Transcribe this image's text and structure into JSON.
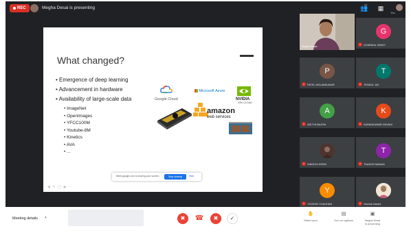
{
  "topbar": {
    "rec_label": "REC",
    "presenting_text": "Megha Desai is presenting",
    "people_count": "27",
    "chat_label": "",
    "you_label": "You"
  },
  "slide": {
    "title": "What changed?",
    "bullets": [
      "Emergence of deep learning",
      "Advancement in hardware",
      "Availability of large-scale data"
    ],
    "sub_bullets": [
      "ImageNet",
      "OpenImages",
      "YFCC100M",
      "Youtube-8M",
      "Kinetics",
      "AVA",
      "..."
    ],
    "logos": {
      "google_cloud": "Google Cloud",
      "microsoft_azure": "Microsoft Azure",
      "nvidia": "NVIDIA",
      "nvidia_sub": "GPU CLOUD",
      "amazon": "amazon",
      "aws": "web services"
    },
    "share_bar": {
      "message": "Meet.google.com is sharing your screen.",
      "stop_label": "Stop sharing",
      "hide_label": "Hide"
    }
  },
  "participants": {
    "presenter_name": "Megha Desai",
    "tiles": [
      {
        "initial": "G",
        "name": "GUNDMAL SWATI",
        "color": "#e8336d"
      },
      {
        "initial": "P",
        "name": "PATEL MOLANKUMAR",
        "color": "#795548"
      },
      {
        "initial": "T",
        "name": "TENDUL JAY",
        "color": "#00796b"
      },
      {
        "initial": "A",
        "name": "ADITYA BAJPAI",
        "color": "#43a047"
      },
      {
        "initial": "K",
        "name": "KARANKUMAR DEVANI",
        "color": "#e64a19"
      },
      {
        "initial": "",
        "name": "SINGHVI KRISH",
        "color": "#5d4037"
      },
      {
        "initial": "T",
        "name": "THAKOR MANAN",
        "color": "#8e24aa"
      },
      {
        "initial": "Y",
        "name": "YOGESH CHAUHAN",
        "color": "#fb8c00"
      },
      {
        "initial": "",
        "name": "Vineeta Nahed",
        "color": "#6d4c41"
      }
    ]
  },
  "bottombar": {
    "meeting_details": "Meeting details",
    "raise_hand": "Raise hand",
    "turn_on_captions": "Turn on captions",
    "presenting_label": "Megha Desai",
    "presenting_sub": "is presenting"
  },
  "colors": {
    "rec_red": "#d93025",
    "control_red": "#ea4335",
    "meet_dark": "#202124",
    "accent_blue": "#1a73e8"
  }
}
